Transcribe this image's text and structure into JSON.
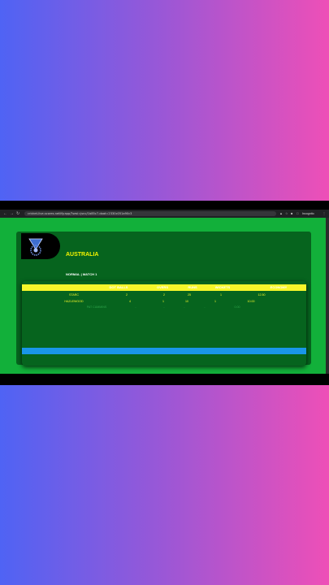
{
  "browser": {
    "url": "cricket-live-scores.netlify.app/?sesi=jsnc/1b85c7-doat=2330c051a90c3",
    "incognito_label": "Incognito"
  },
  "header": {
    "team_name": "AUSTRALIA",
    "match_label": "NORMAL | MATCH 1"
  },
  "table": {
    "columns": [
      "DOT BALLS",
      "OVERS",
      "RUNS",
      "WICKETS",
      "ECONOMY"
    ],
    "rows": [
      {
        "name": "STARC",
        "values": [
          "2",
          "2",
          "25",
          "1",
          "12.50"
        ],
        "color": "#f6f62a"
      },
      {
        "name": "HAZLEWOOD",
        "values": [
          "4",
          "1",
          "10",
          "1",
          "10.00"
        ],
        "color": "#f6f62a"
      },
      {
        "name": "PAT CUMMINS",
        "values": [
          "-",
          "-",
          "-",
          "-",
          "0.00"
        ],
        "color": "#2fa64c"
      }
    ]
  },
  "colors": {
    "accent_yellow": "#f6f62a",
    "panel_green": "#06641e",
    "page_green": "#12b03a",
    "stripe_blue": "#1996e8"
  }
}
